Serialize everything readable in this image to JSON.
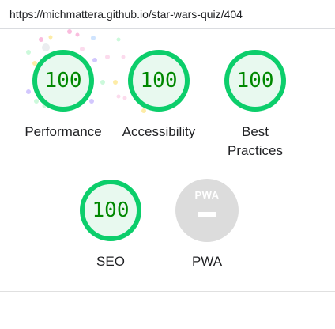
{
  "address_bar": {
    "url": "https://michmattera.github.io/star-wars-quiz/404"
  },
  "colors": {
    "pass_green": "#0cce6b",
    "pass_fill": "#e8f9ef",
    "score_text": "#008800",
    "pwa_gray": "#dcdcdc"
  },
  "gauges": [
    {
      "id": "performance",
      "score": "100",
      "label": "Performance"
    },
    {
      "id": "accessibility",
      "score": "100",
      "label": "Accessibility"
    },
    {
      "id": "best-practices",
      "score": "100",
      "label_line1": "Best",
      "label_line2": "Practices"
    },
    {
      "id": "seo",
      "score": "100",
      "label": "SEO"
    }
  ],
  "pwa": {
    "logo_text": "PWA",
    "label": "PWA",
    "icon": "pwa-badge-icon"
  }
}
